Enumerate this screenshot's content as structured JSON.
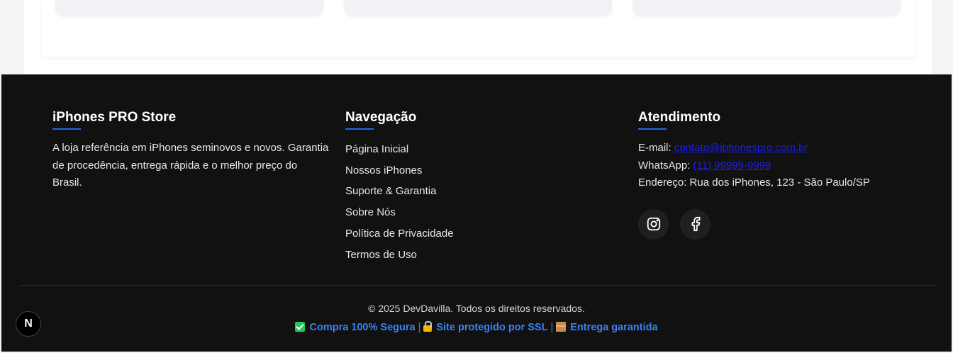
{
  "footer": {
    "about": {
      "title": "iPhones PRO Store",
      "text": "A loja referência em iPhones seminovos e novos. Garantia de procedência, entrega rápida e o melhor preço do Brasil."
    },
    "nav": {
      "title": "Navegação",
      "items": [
        "Página Inicial",
        "Nossos iPhones",
        "Suporte & Garantia",
        "Sobre Nós",
        "Política de Privacidade",
        "Termos de Uso"
      ]
    },
    "contact": {
      "title": "Atendimento",
      "email_label": "E-mail:",
      "email": "contato@iphonespro.com.br",
      "whatsapp_label": "WhatsApp:",
      "whatsapp": "(11) 99999-9999",
      "address": "Endereço: Rua dos iPhones, 123 - São Paulo/SP",
      "socials": [
        "instagram-icon",
        "facebook-icon"
      ]
    },
    "copyright": "© 2025 DevDavilla. Todos os direitos reservados.",
    "badges": [
      "Compra 100% Segura",
      "Site protegido por SSL",
      "Entrega garantida"
    ],
    "separator": "|"
  },
  "dev_badge": "N",
  "colors": {
    "footer_bg": "#111111",
    "accent": "#2563eb",
    "link": "#1d1df0",
    "badge_text": "#3b82f6"
  }
}
